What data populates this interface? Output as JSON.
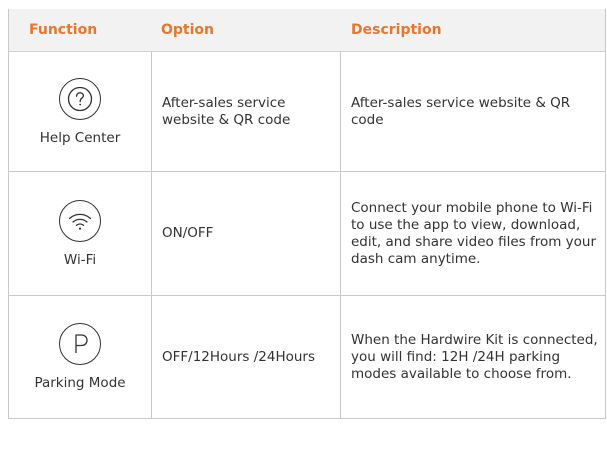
{
  "table": {
    "headers": {
      "function": "Function",
      "option": "Option",
      "description": "Description"
    },
    "rows": [
      {
        "icon": "question-icon",
        "function": "Help Center",
        "option": "After-sales service website & QR code",
        "description": "After-sales service website & QR code"
      },
      {
        "icon": "wifi-icon",
        "function": "Wi-Fi",
        "option": "ON/OFF",
        "description": "Connect your mobile phone to Wi-Fi to use the app to view, download, edit, and share video files from your dash cam anytime."
      },
      {
        "icon": "parking-p-icon",
        "function": "Parking Mode",
        "option": "OFF/12Hours /24Hours",
        "description": "When the Hardwire Kit is connected, you will find: 12H /24H parking modes available to choose from."
      }
    ]
  },
  "colors": {
    "header_text": "#e8772e",
    "header_bg": "#f2f2f2",
    "border": "#c9c9c9"
  }
}
